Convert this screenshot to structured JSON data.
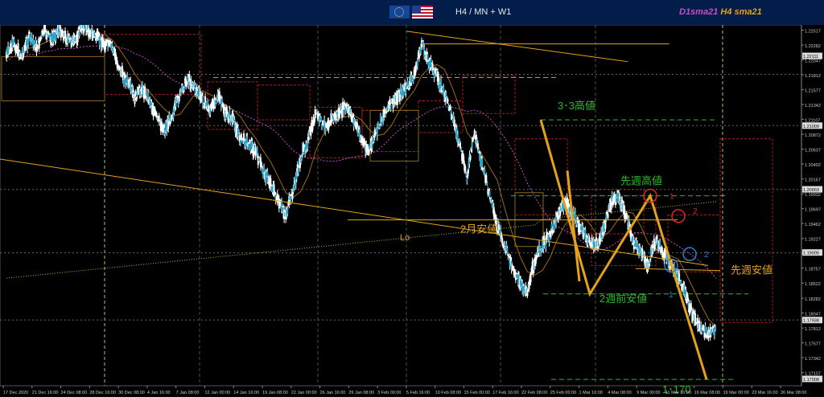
{
  "header": {
    "timeframes": "H4 / MN + W1",
    "sma_d1": "D1sma21",
    "sma_h4": "H4 sma21",
    "flag_eu": "eu-flag-icon",
    "flag_us": "us-flag-icon"
  },
  "colors": {
    "background": "#000000",
    "header_bg": "#031d4a",
    "candle": "#ffffff",
    "candle_up_body": "#29a4c9",
    "trendline": "#e3a21a",
    "annotation_green": "#2eb82e",
    "annotation_orange": "#e3a21a",
    "box": "#b01c1c",
    "d1_sma": "#c74ec7",
    "h4_sma": "#e3a21a",
    "marker_red": "#d42a2a",
    "marker_blue": "#2b7fd6"
  },
  "chart_data": {
    "type": "candlestick",
    "symbol": "EURUSD",
    "ylim": [
      1.169,
      1.226
    ],
    "y_ticks": [
      "1.22517",
      "1.22282",
      "1.22047",
      "1.21812",
      "1.21577",
      "1.21342",
      "1.21107",
      "1.20872",
      "1.20637",
      "1.20402",
      "1.20167",
      "1.19932",
      "1.19697",
      "1.19462",
      "1.19227",
      "1.18992",
      "1.18757",
      "1.18522",
      "1.18282",
      "1.18047",
      "1.17812",
      "1.17577",
      "1.17342",
      "1.17107",
      "1.16872"
    ],
    "y_highlight_labels": [
      "1.22111",
      "1.21009",
      "1.20003",
      "1.19005",
      "1.17938",
      "1.17008"
    ],
    "x_ticks": [
      "17 Dec 2020",
      "21 Dec 16:00",
      "24 Dec 08:00",
      "28 Dec 16:00",
      "30 Dec 08:00",
      "4 Jan 16:00",
      "7 Jan 08:00",
      "12 Jan 00:00",
      "14 Jan 16:00",
      "19 Jan 08:00",
      "22 Jan 00:00",
      "26 Jan 16:00",
      "29 Jan 08:00",
      "3 Feb 00:00",
      "5 Feb 16:00",
      "10 Feb 08:00",
      "15 Feb 00:00",
      "17 Feb 16:00",
      "22 Feb 08:00",
      "25 Feb 00:00",
      "1 Mar 16:00",
      "4 Mar 08:00",
      "9 Mar 00:00",
      "11 Mar 16:00",
      "16 Mar 08:00",
      "19 Mar 00:00",
      "23 Mar 16:00",
      "26 Mar 08:00"
    ],
    "close_path": [
      1.2212,
      1.223,
      1.221,
      1.224,
      1.2225,
      1.225,
      1.2236,
      1.2255,
      1.2238,
      1.2232,
      1.226,
      1.225,
      1.224,
      1.223,
      1.2225,
      1.219,
      1.217,
      1.2145,
      1.216,
      1.214,
      1.211,
      1.2095,
      1.212,
      1.215,
      1.2175,
      1.216,
      1.214,
      1.2125,
      1.215,
      1.212,
      1.211,
      1.208,
      1.2075,
      1.206,
      1.203,
      1.201,
      1.198,
      1.196,
      1.2,
      1.205,
      1.208,
      1.212,
      1.21,
      1.211,
      1.212,
      1.213,
      1.211,
      1.208,
      1.206,
      1.209,
      1.212,
      1.2135,
      1.215,
      1.216,
      1.218,
      1.223,
      1.22,
      1.218,
      1.215,
      1.212,
      1.207,
      1.202,
      1.209,
      1.204,
      1.199,
      1.194,
      1.191,
      1.188,
      1.185,
      1.184,
      1.189,
      1.191,
      1.193,
      1.196,
      1.198,
      1.196,
      1.194,
      1.192,
      1.191,
      1.193,
      1.198,
      1.199,
      1.196,
      1.192,
      1.19,
      1.188,
      1.192,
      1.19,
      1.188,
      1.186,
      1.183,
      1.18,
      1.178,
      1.177,
      1.1782
    ],
    "annotations": {
      "high_33": "3･3高値",
      "last_week_high": "先週高値",
      "feb_low": "2月安値",
      "last_week_low": "先週安値",
      "two_weeks_low": "2週前安値",
      "lo": "Lo",
      "target": "1･170",
      "marker_red_1": "1",
      "marker_red_2": "2",
      "marker_blue_1": "1",
      "marker_blue_2": "2"
    },
    "levels": {
      "high_33": 1.211,
      "last_week_high": 1.199,
      "feb_low": 1.1952,
      "two_weeks_low": 1.1835,
      "last_week_low": 1.1875,
      "target": 1.17,
      "current": 1.1794,
      "dotted_top": 1.2182,
      "mn_top": 1.2245
    },
    "trend_points": [
      {
        "label": "3/3 high",
        "value": 1.211
      },
      {
        "label": "2wk low",
        "value": 1.1835
      },
      {
        "label": "last week high",
        "value": 1.199
      },
      {
        "label": "target",
        "value": 1.17
      }
    ]
  }
}
